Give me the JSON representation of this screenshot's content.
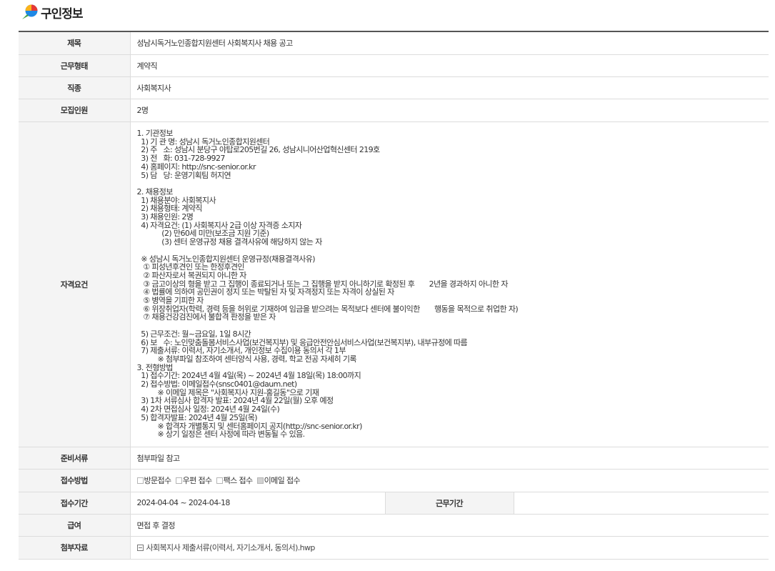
{
  "header": {
    "title": "구인정보"
  },
  "rows": {
    "title": {
      "label": "제목",
      "value": "성남시독거노인종합지원센터 사회복지사 채용 공고"
    },
    "employment_type": {
      "label": "근무형태",
      "value": "계약직"
    },
    "job": {
      "label": "직종",
      "value": "사회복지사"
    },
    "headcount": {
      "label": "모집인원",
      "value": "2명"
    },
    "qualification": {
      "label": "자격요건",
      "text": "1. 기관정보\n  1) 기 관 명: 성남시 독거노인종합지원센터\n  2) 주   소: 성남시 분당구 야탑로205번길 26, 성남시니어산업혁신센터 219호\n  3) 전   화: 031-728-9927\n  4) 홈페이지: http://snc-senior.or.kr\n  5) 담   당: 운영기획팀 허지연\n\n2. 채용정보\n  1) 채용분야: 사회복지사\n  2) 채용형태: 계약직\n  3) 채용인원: 2명\n  4) 자격요건: (1) 사회복지사 2급 이상 자격증 소지자\n            (2) 만60세 미만(보조금 지원 기준)\n            (3) 센터 운영규정 채용 결격사유에 해당하지 않는 자\n\n  ※ 성남시 독거노인종합지원센터 운영규정(채용결격사유)\n   ① 피성년후견인 또는 한정후견인\n   ② 파산자로서 복권되지 아니한 자\n   ③ 금고이상의 형을 받고 그 집행이 종료되거나 또는 그 집행을 받지 아니하기로 확정된 후       2년을 경과하지 아니한 자\n   ④ 법률에 의하여 공민권이 정지 또는 박탈된 자 및 자격정지 또는 자격이 상실된 자\n   ⑤ 병역을 기피한 자\n   ⑥ 위장취업자(학력, 경력 등을 허위로 기재하여 임금을 받으려는 목적보다 센터에 불이익한       행동을 목적으로 취업한 자)\n   ⑦ 채용건강검진에서 불합격 판정을 받은 자\n\n  5) 근무조건: 월~금요일, 1일 8시간\n  6) 보   수: 노인맞춤돌봄서비스사업(보건복지부) 및 응급안전안심서비스사업(보건복지부), 내부규정에 따름\n  7) 제출서류: 이력서, 자기소개서, 개인정보 수집이용 동의서 각 1부\n          ※ 첨부파일 참조하여 센터양식 사용, 경력, 학교 전공 자세히 기록\n3. 전형방법\n  1) 접수기간: 2024년 4월 4일(목) ~ 2024년 4월 18일(목) 18:00까지\n  2) 접수방법: 이메일접수(snsc0401@daum.net)\n          ※ 이메일 제목은 \"사회복지사 지원-홍길동\"으로 기재\n  3) 1차 서류심사 합격자 발표: 2024년 4월 22일(월) 오후 예정\n  4) 2차 면접심사 일정: 2024년 4월 24일(수)\n  5) 합격자발표: 2024년 4월 25일(목)\n          ※ 합격자 개별통지 및 센터홈페이지 공지(http://snc-senior.or.kr)\n          ※ 상기 일정은 센터 사정에 따라 변동될 수 있음."
    },
    "documents": {
      "label": "준비서류",
      "value": "첨부파일 참고"
    },
    "method": {
      "label": "접수방법",
      "options": [
        {
          "label": "방문접수",
          "checked": false
        },
        {
          "label": "우편 접수",
          "checked": false
        },
        {
          "label": "팩스 접수",
          "checked": false
        },
        {
          "label": "이메일 접수",
          "checked": true
        }
      ]
    },
    "period": {
      "label": "접수기간",
      "value": "2024-04-04 ~ 2024-04-18",
      "work_label": "근무기간",
      "work_value": ""
    },
    "salary": {
      "label": "급여",
      "value": "면접 후 결정"
    },
    "attachment": {
      "label": "첨부자료",
      "file": "사회복지사 제출서류(이력서, 자기소개서, 동의서).hwp"
    }
  },
  "colors": {
    "header_bg": "#f4f4f4",
    "border": "#dcdcdc",
    "top_border": "#555555",
    "logo_red": "#e53935",
    "logo_yellow": "#fbb31b",
    "logo_blue": "#1e88e5",
    "logo_green": "#43a047"
  }
}
